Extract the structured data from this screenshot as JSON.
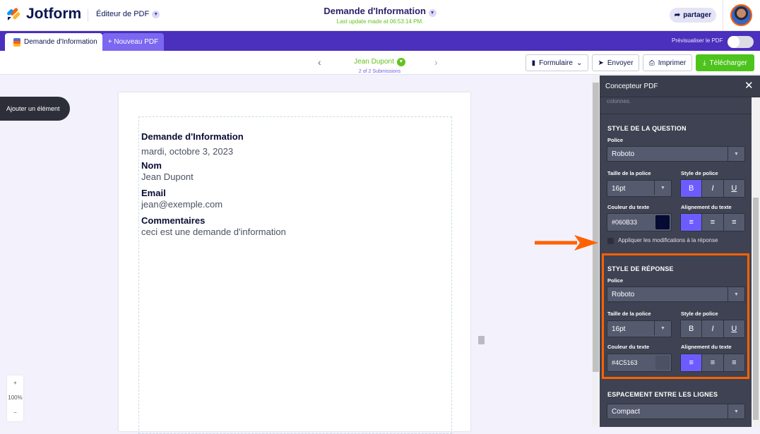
{
  "header": {
    "brand": "Jotform",
    "editor_label": "Éditeur de PDF",
    "title": "Demande d'Information",
    "last_update": "Last update made at 06:53:14 PM.",
    "share_label": "partager"
  },
  "tabs": {
    "active": "Demande d'Information",
    "new": "+ Nouveau PDF",
    "preview_label": "Prévisualiser le PDF",
    "preview_on": false
  },
  "toolbar": {
    "submitter": "Jean Dupont",
    "submission_count": "2 of 2 Submissions",
    "form_btn": "Formulaire",
    "send_btn": "Envoyer",
    "print_btn": "Imprimer",
    "download_btn": "Télécharger"
  },
  "canvas": {
    "add_element": "Ajouter un élément",
    "zoom_in": "+",
    "zoom_level": "100%",
    "zoom_out": "−"
  },
  "document": {
    "title": "Demande d'Information",
    "date": "mardi, octobre 3, 2023",
    "fields": [
      {
        "q": "Nom",
        "a": "Jean Dupont"
      },
      {
        "q": "Email",
        "a": "jean@exemple.com"
      },
      {
        "q": "Commentaires",
        "a": "ceci est une demande d'information"
      }
    ]
  },
  "panel": {
    "title": "Concepteur PDF",
    "hint": "colonnes.",
    "question_style": {
      "heading": "STYLE DE LA QUESTION",
      "font_label": "Police",
      "font": "Roboto",
      "size_label": "Taille de la police",
      "size": "16pt",
      "style_label": "Style de police",
      "bold": "B",
      "italic": "I",
      "underline": "U",
      "color_label": "Couleur du texte",
      "color": "#060B33",
      "align_label": "Alignement du texte",
      "bold_on": true
    },
    "apply_label": "Appliquer les modifications à la réponse",
    "answer_style": {
      "heading": "STYLE DE RÉPONSE",
      "font_label": "Police",
      "font": "Roboto",
      "size_label": "Taille de la police",
      "size": "16pt",
      "style_label": "Style de police",
      "bold": "B",
      "italic": "I",
      "underline": "U",
      "color_label": "Couleur du texte",
      "color": "#4C5163",
      "align_label": "Alignement du texte",
      "bold_on": false
    },
    "spacing": {
      "heading": "ESPACEMENT ENTRE LES LIGNES",
      "value": "Compact"
    }
  },
  "colors": {
    "brand_purple": "#4b2fbd",
    "accent": "#6c5cff",
    "green": "#4cc41c",
    "highlight": "#ff6100"
  }
}
